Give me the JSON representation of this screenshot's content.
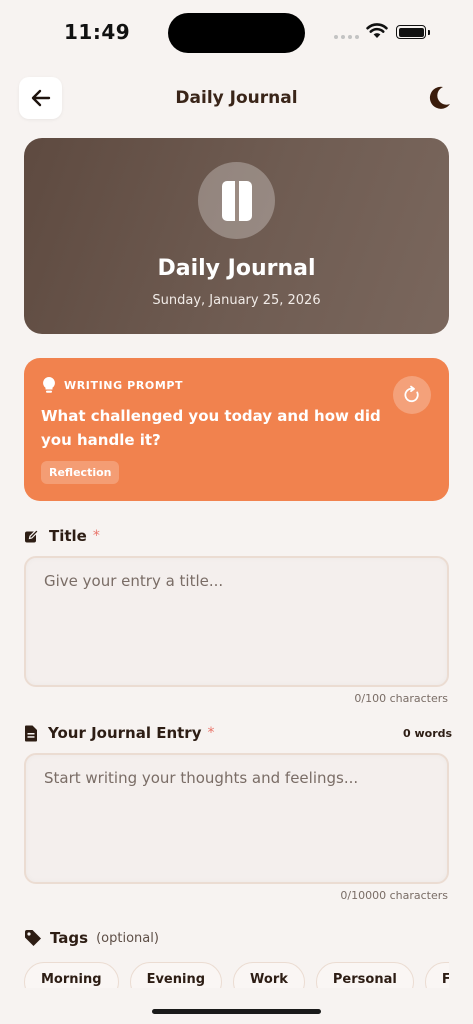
{
  "status_bar": {
    "time": "11:49"
  },
  "header": {
    "title": "Daily Journal"
  },
  "hero": {
    "title": "Daily Journal",
    "date": "Sunday, January 25, 2026"
  },
  "prompt": {
    "label": "WRITING PROMPT",
    "text": "What challenged you today and how did you handle it?",
    "category": "Reflection"
  },
  "title_field": {
    "label": "Title",
    "required_mark": "*",
    "placeholder": "Give your entry a title...",
    "char_count": "0/100 characters"
  },
  "entry_field": {
    "label": "Your Journal Entry",
    "required_mark": "*",
    "word_count": "0 words",
    "placeholder": "Start writing your thoughts and feelings...",
    "char_count": "0/10000 characters"
  },
  "tags": {
    "label": "Tags",
    "optional": "(optional)",
    "items": [
      "Morning",
      "Evening",
      "Work",
      "Personal",
      "Family"
    ]
  },
  "colors": {
    "background": "#f7f3f1",
    "hero": "#6a564c",
    "prompt": "#f1824e",
    "text": "#3a2519",
    "required": "#e9746a"
  },
  "icons": [
    "back-arrow-icon",
    "moon-icon",
    "book-icon",
    "lightbulb-icon",
    "refresh-icon",
    "edit-icon",
    "document-icon",
    "tag-icon"
  ]
}
